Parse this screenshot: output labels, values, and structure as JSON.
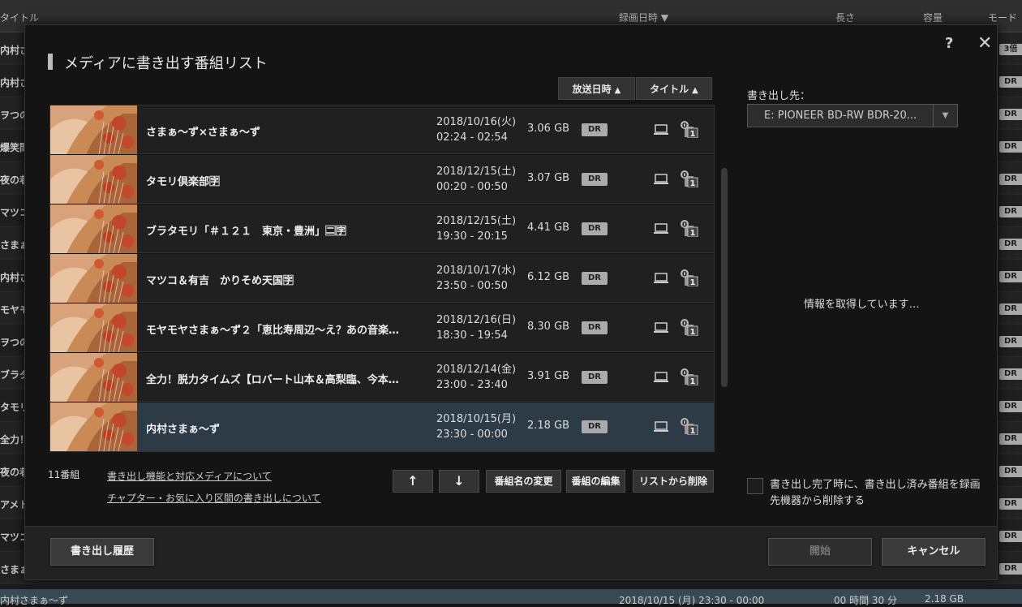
{
  "background": {
    "header": {
      "col_title": "タイトル",
      "col_date": "録画日時",
      "col_length": "長さ",
      "col_size": "容量",
      "col_mode": "モード"
    },
    "rows": [
      {
        "left": "内村さ",
        "badge": "3倍"
      },
      {
        "left": "内村さ",
        "badge": "DR"
      },
      {
        "left": "ヲつの",
        "badge": "DR"
      },
      {
        "left": "爆笑問",
        "badge": "DR"
      },
      {
        "left": "夜の巷",
        "badge": "DR"
      },
      {
        "left": "マツコ",
        "badge": "DR"
      },
      {
        "left": "さまぁ",
        "badge": "DR"
      },
      {
        "left": "内村さ",
        "badge": "DR"
      },
      {
        "left": "モヤモ",
        "badge": "DR"
      },
      {
        "left": "ヲつの",
        "badge": "DR"
      },
      {
        "left": "ブラタ",
        "badge": "DR"
      },
      {
        "left": "タモリ",
        "badge": "DR"
      },
      {
        "left": "全力！",
        "badge": "DR"
      },
      {
        "left": "夜の巷",
        "badge": "DR"
      },
      {
        "left": "アメト",
        "badge": "DR"
      },
      {
        "left": "マツコ",
        "badge": "DR"
      },
      {
        "left": "さまぁ",
        "badge": "DR"
      }
    ],
    "bottom": {
      "title": "内村さまぁ～ず",
      "date": "2018/10/15 (月) 23:30 - 00:00",
      "length": "00 時間 30 分",
      "size": "2.18 GB"
    }
  },
  "dialog": {
    "title": "メディアに書き出す番組リスト",
    "help": "?",
    "close": "✕",
    "sort_broadcast": "放送日時",
    "sort_title": "タイトル",
    "programs": [
      {
        "title": "さまぁ～ず×さまぁ～ず",
        "date": "2018/10/16(火)",
        "time": "02:24 - 02:54",
        "size": "3.06 GB",
        "mode": "DR"
      },
      {
        "title": "タモリ倶楽部🈑",
        "date": "2018/12/15(土)",
        "time": "00:20 - 00:50",
        "size": "3.07 GB",
        "mode": "DR"
      },
      {
        "title": "ブラタモリ「＃１２１　東京・豊洲」🈔🈑",
        "date": "2018/12/15(土)",
        "time": "19:30 - 20:15",
        "size": "4.41 GB",
        "mode": "DR"
      },
      {
        "title": "マツコ＆有吉　かりそめ天国🈑",
        "date": "2018/10/17(水)",
        "time": "23:50 - 00:50",
        "size": "6.12 GB",
        "mode": "DR"
      },
      {
        "title": "モヤモヤさまぁ～ず２「恵比寿周辺～え？あの音楽…",
        "date": "2018/12/16(日)",
        "time": "18:30 - 19:54",
        "size": "8.30 GB",
        "mode": "DR"
      },
      {
        "title": "全力！脱力タイムズ【ロバート山本＆高梨臨、今本…",
        "date": "2018/12/14(金)",
        "time": "23:00 - 23:40",
        "size": "3.91 GB",
        "mode": "DR"
      },
      {
        "title": "内村さまぁ～ず",
        "date": "2018/10/15(月)",
        "time": "23:30 - 00:00",
        "size": "2.18 GB",
        "mode": "DR"
      }
    ],
    "count": "11番組",
    "link1": "書き出し機能と対応メディアについて",
    "link2": "チャプター・お気に入り区間の書き出しについて",
    "btn_up": "↑",
    "btn_down": "↓",
    "btn_rename": "番組名の変更",
    "btn_edit": "番組の編集",
    "btn_remove": "リストから削除",
    "dest_label": "書き出し先：",
    "dest_value": "E:  PIONEER  BD-RW     BDR-20...",
    "info": "情報を取得しています…",
    "checkbox_label": "書き出し完了時に、書き出し済み番組を録画先機器から削除する",
    "btn_history": "書き出し履歴",
    "btn_start": "開始",
    "btn_cancel": "キャンセル"
  },
  "colors": {
    "selected_row": "#2c3b46",
    "badge": "#aaaaaa"
  }
}
